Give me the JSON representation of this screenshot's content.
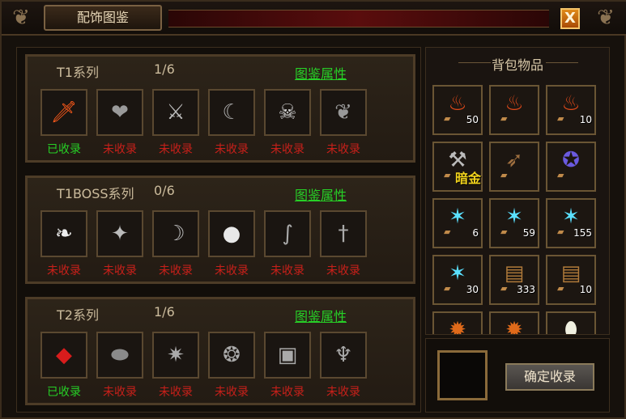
{
  "window": {
    "title": "配饰图鉴",
    "close_label": "X"
  },
  "series": [
    {
      "name": "T1系列",
      "count": "1/6",
      "attr_link": "图鉴属性",
      "items": [
        {
          "icon": "sword-pendant-icon",
          "glyph": "🗡",
          "color": "#ff5a1a",
          "status": "已收录",
          "collected": true
        },
        {
          "icon": "heart-icon",
          "glyph": "❤",
          "color": "#9a9a9a",
          "status": "未收录",
          "collected": false
        },
        {
          "icon": "crossed-weapons-icon",
          "glyph": "⚔",
          "color": "#bbbbbb",
          "status": "未收录",
          "collected": false
        },
        {
          "icon": "claw-icon",
          "glyph": "☾",
          "color": "#aaaaaa",
          "status": "未收录",
          "collected": false
        },
        {
          "icon": "skull-orb-icon",
          "glyph": "☠",
          "color": "#cccccc",
          "status": "未收录",
          "collected": false
        },
        {
          "icon": "wings-icon",
          "glyph": "❦",
          "color": "#999999",
          "status": "未收录",
          "collected": false
        }
      ]
    },
    {
      "name": "T1BOSS系列",
      "count": "0/6",
      "attr_link": "图鉴属性",
      "items": [
        {
          "icon": "feather-icon",
          "glyph": "❧",
          "color": "#eeeeee",
          "status": "未收录",
          "collected": false
        },
        {
          "icon": "staff-icon",
          "glyph": "✦",
          "color": "#bbbbbb",
          "status": "未收录",
          "collected": false
        },
        {
          "icon": "fang-icon",
          "glyph": "☽",
          "color": "#bbbbbb",
          "status": "未收录",
          "collected": false
        },
        {
          "icon": "glow-orb-icon",
          "glyph": "●",
          "color": "#e8e8e8",
          "status": "未收录",
          "collected": false
        },
        {
          "icon": "serpent-icon",
          "glyph": "∫",
          "color": "#aaaaaa",
          "status": "未收录",
          "collected": false
        },
        {
          "icon": "scepter-icon",
          "glyph": "†",
          "color": "#aaaaaa",
          "status": "未收录",
          "collected": false
        }
      ]
    },
    {
      "name": "T2系列",
      "count": "1/6",
      "attr_link": "图鉴属性",
      "items": [
        {
          "icon": "red-gem-icon",
          "glyph": "◆",
          "color": "#d81c1c",
          "status": "已收录",
          "collected": true
        },
        {
          "icon": "stone-icon",
          "glyph": "⬬",
          "color": "#8a8a8a",
          "status": "未收录",
          "collected": false
        },
        {
          "icon": "spider-claw-icon",
          "glyph": "✷",
          "color": "#aaaaaa",
          "status": "未收录",
          "collected": false
        },
        {
          "icon": "armor-icon",
          "glyph": "❂",
          "color": "#aaaaaa",
          "status": "未收录",
          "collected": false
        },
        {
          "icon": "book-icon",
          "glyph": "▣",
          "color": "#aaaaaa",
          "status": "未收录",
          "collected": false
        },
        {
          "icon": "idol-icon",
          "glyph": "♆",
          "color": "#aaaaaa",
          "status": "未收录",
          "collected": false
        }
      ]
    }
  ],
  "bag": {
    "title": "背包物品",
    "items": [
      {
        "icon": "red-potion-icon",
        "glyph": "♨",
        "color": "#e04a1a",
        "qty": "50",
        "tag": ""
      },
      {
        "icon": "red-potion-icon",
        "glyph": "♨",
        "color": "#e04a1a",
        "qty": "",
        "tag": ""
      },
      {
        "icon": "red-potion-icon",
        "glyph": "♨",
        "color": "#e04a1a",
        "qty": "10",
        "tag": ""
      },
      {
        "icon": "axe-icon",
        "glyph": "⚒",
        "color": "#bbbbbb",
        "qty": "",
        "tag": "暗金"
      },
      {
        "icon": "wooden-wing-icon",
        "glyph": "➶",
        "color": "#a07040",
        "qty": "",
        "tag": ""
      },
      {
        "icon": "purple-medal-icon",
        "glyph": "✪",
        "color": "#6a5adf",
        "qty": "",
        "tag": ""
      },
      {
        "icon": "crystal-star-icon",
        "glyph": "✶",
        "color": "#5ae0ff",
        "qty": "6",
        "tag": ""
      },
      {
        "icon": "crystal-star-icon",
        "glyph": "✶",
        "color": "#5ae0ff",
        "qty": "59",
        "tag": ""
      },
      {
        "icon": "crystal-star-icon",
        "glyph": "✶",
        "color": "#5ae0ff",
        "qty": "155",
        "tag": ""
      },
      {
        "icon": "crystal-star-icon",
        "glyph": "✶",
        "color": "#5ae0ff",
        "qty": "30",
        "tag": ""
      },
      {
        "icon": "wood-pile-icon",
        "glyph": "▤",
        "color": "#b07a3a",
        "qty": "333",
        "tag": ""
      },
      {
        "icon": "wood-pile-icon",
        "glyph": "▤",
        "color": "#b07a3a",
        "qty": "10",
        "tag": ""
      },
      {
        "icon": "fire-orb-icon",
        "glyph": "✹",
        "color": "#e06a1a",
        "qty": "",
        "tag": ""
      },
      {
        "icon": "fire-orb-icon",
        "glyph": "✹",
        "color": "#e06a1a",
        "qty": "",
        "tag": ""
      },
      {
        "icon": "egg-icon",
        "glyph": "⬮",
        "color": "#f0f0e0",
        "qty": "",
        "tag": ""
      }
    ]
  },
  "confirm_button": "确定收录"
}
